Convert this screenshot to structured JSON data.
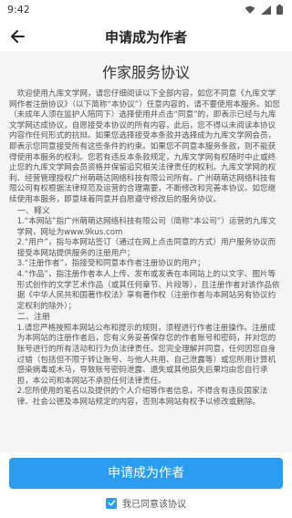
{
  "status_bar": {
    "time": "9:42",
    "icons": [
      "wifi-icon",
      "signal-icon",
      "battery-icon"
    ]
  },
  "header": {
    "title": "申请成为作者"
  },
  "agreement": {
    "title": "作家服务协议",
    "intro": "欢迎使用九库文学网，请您仔细阅读以下全部内容，如您不同意《九库文学网作者注册协议》（以下简称“本协议”）任意内容的，请不要使用本服务。如您（未成年人须在监护人陪同下）选择使用并点击“同意”的，即表示已经与九库文学网达成协议，自愿接受本协议的所有内容，此后，您不得以未阅读本协议内容作任何形式的抗辩。如果您选择接受本条款并选择成为九库文学网会员，即表示您同意接受所有这些条件的约束。如果您不同意本服务条款，则不能获得使用本服务的权利。您若有违反本条款规定，九库文学网有权随时中止或终止您的九库文学网会员资格并保留追究相关法律责任的权利。九库文学网的权利、经营管理授权广州萌萌达网络科技有限公司所有。广州萌萌达网络科技有限公司有权根据法律规范及运营的合理需要，不断修改和完善本协议。如您继续使用本服务，即意味着同意并自愿遵守修改后的服务协议。",
    "section1_head": "一、释义",
    "section1_items": [
      "1.“本网站”指广州萌萌达网络科技有限公司（简称“本公司”）运营的九库文学网，网址为www.9kus.com",
      "2.“用户”，指与本网站签订（通过在网上点击同意的方式）用户服务协议而接受本网站提供服务的注册用户；",
      "3.“注册作者”，指接受和同意本作者注册协议的用户；",
      "4.“作品”，指注册作者本人上传、发布或发表在本网站上的以文字、图片等形式创作的文学艺术作品（或其任何章节、片段等），且注册作者对该作品依据《中华人民共和国著作权法》享有著作权（注册作者与本网站另有协议约定权利的除外）；"
    ],
    "section2_head": "二、注册",
    "section2_items": [
      "1.请您严格按照本网站公布和提示的规则，须程进行作者注册操作。注册成为本网站的注册作者后，您有义务妥善保存您的作者账号和密码，并对您的账号进行的所有活动和行为负法律责任。您完全理解并同意，任何因您自身过错（包括但不限于转让账号、与他人共用、自己泄露等）或您所用计算机感染病毒或木马，导致账号密码泄露、遗失或其他损失后果均由您自行承担，本公司和本网站不承担任何法律责任。",
      "2.您所使用的笔名以及提供的个人介绍等作者信息，不得含有违反国家法律、社会公德及本网站规定的内容，否则本网站有权予以修改或删除。"
    ]
  },
  "footer": {
    "submit_label": "申请成为作者",
    "consent_label": "我已同意该协议",
    "consent_checked": true
  },
  "colors": {
    "accent": "#2b9df0",
    "background": "#f5f5f5"
  }
}
